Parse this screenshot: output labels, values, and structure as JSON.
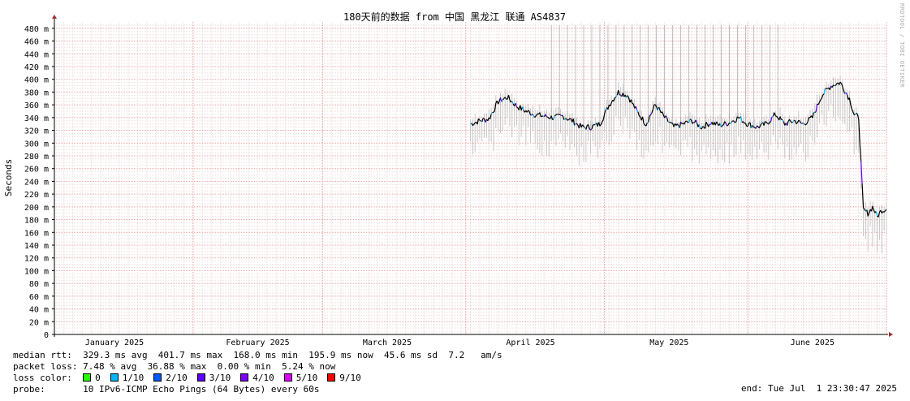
{
  "chart_data": {
    "type": "line",
    "title": "180天前的数据 from 中国 黑龙江 联通 AS4837",
    "ylabel": "Seconds",
    "ylim": [
      0,
      490
    ],
    "y_ticks": [
      "0",
      "20 m",
      "40 m",
      "60 m",
      "80 m",
      "100 m",
      "120 m",
      "140 m",
      "160 m",
      "180 m",
      "200 m",
      "220 m",
      "240 m",
      "260 m",
      "280 m",
      "300 m",
      "320 m",
      "340 m",
      "360 m",
      "380 m",
      "400 m",
      "420 m",
      "440 m",
      "460 m",
      "480 m"
    ],
    "y_tick_values": [
      0,
      20,
      40,
      60,
      80,
      100,
      120,
      140,
      160,
      180,
      200,
      220,
      240,
      260,
      280,
      300,
      320,
      340,
      360,
      380,
      400,
      420,
      440,
      460,
      480
    ],
    "x_range": [
      "2025-01-02",
      "2025-07-01"
    ],
    "x_labels": [
      {
        "label": "January 2025",
        "date": "2025-01-15"
      },
      {
        "label": "February 2025",
        "date": "2025-02-15"
      },
      {
        "label": "March 2025",
        "date": "2025-03-15"
      },
      {
        "label": "April 2025",
        "date": "2025-04-15"
      },
      {
        "label": "May 2025",
        "date": "2025-05-15"
      },
      {
        "label": "June 2025",
        "date": "2025-06-15"
      }
    ],
    "grid": true,
    "series": [
      {
        "name": "median rtt",
        "color": "#000000",
        "points": [
          [
            "2025-04-02",
            330
          ],
          [
            "2025-04-04",
            335
          ],
          [
            "2025-04-06",
            338
          ],
          [
            "2025-04-08",
            365
          ],
          [
            "2025-04-10",
            372
          ],
          [
            "2025-04-12",
            358
          ],
          [
            "2025-04-14",
            350
          ],
          [
            "2025-04-16",
            345
          ],
          [
            "2025-04-18",
            342
          ],
          [
            "2025-04-20",
            340
          ],
          [
            "2025-04-22",
            342
          ],
          [
            "2025-04-24",
            335
          ],
          [
            "2025-04-26",
            325
          ],
          [
            "2025-04-28",
            325
          ],
          [
            "2025-04-30",
            330
          ],
          [
            "2025-05-02",
            360
          ],
          [
            "2025-05-04",
            380
          ],
          [
            "2025-05-06",
            375
          ],
          [
            "2025-05-08",
            350
          ],
          [
            "2025-05-10",
            330
          ],
          [
            "2025-05-12",
            360
          ],
          [
            "2025-05-14",
            340
          ],
          [
            "2025-05-16",
            325
          ],
          [
            "2025-05-18",
            330
          ],
          [
            "2025-05-20",
            335
          ],
          [
            "2025-05-22",
            325
          ],
          [
            "2025-05-24",
            332
          ],
          [
            "2025-05-26",
            328
          ],
          [
            "2025-05-28",
            332
          ],
          [
            "2025-05-30",
            340
          ],
          [
            "2025-06-01",
            330
          ],
          [
            "2025-06-03",
            325
          ],
          [
            "2025-06-05",
            330
          ],
          [
            "2025-06-07",
            345
          ],
          [
            "2025-06-09",
            330
          ],
          [
            "2025-06-11",
            335
          ],
          [
            "2025-06-13",
            330
          ],
          [
            "2025-06-15",
            340
          ],
          [
            "2025-06-17",
            375
          ],
          [
            "2025-06-19",
            390
          ],
          [
            "2025-06-21",
            395
          ],
          [
            "2025-06-23",
            370
          ],
          [
            "2025-06-24",
            345
          ],
          [
            "2025-06-25",
            340
          ],
          [
            "2025-06-26",
            195
          ],
          [
            "2025-06-27",
            190
          ],
          [
            "2025-06-28",
            200
          ],
          [
            "2025-06-29",
            185
          ],
          [
            "2025-06-30",
            195
          ],
          [
            "2025-07-01",
            196
          ]
        ]
      }
    ],
    "loss_levels": [
      {
        "label": "0",
        "color": "#26ff00"
      },
      {
        "label": "1/10",
        "color": "#00b8ff"
      },
      {
        "label": "2/10",
        "color": "#0059ff"
      },
      {
        "label": "3/10",
        "color": "#5e00ff"
      },
      {
        "label": "4/10",
        "color": "#7e00ff"
      },
      {
        "label": "5/10",
        "color": "#dd00ff"
      },
      {
        "label": "9/10",
        "color": "#ff0000"
      }
    ]
  },
  "legend": {
    "median_rtt": "median rtt:  329.3 ms avg  401.7 ms max  168.0 ms min  195.9 ms now  45.6 ms sd  7.2   am/s",
    "packet_loss": "packet loss: 7.48 % avg  36.88 % max  0.00 % min  5.24 % now",
    "loss_color_label": "loss color:",
    "probe": "probe:       10 IPv6-ICMP Echo Pings (64 Bytes) every 60s",
    "end": "end: Tue Jul  1 23:30:47 2025"
  },
  "watermark": "RRDTOOL / TOBI OETIKER"
}
